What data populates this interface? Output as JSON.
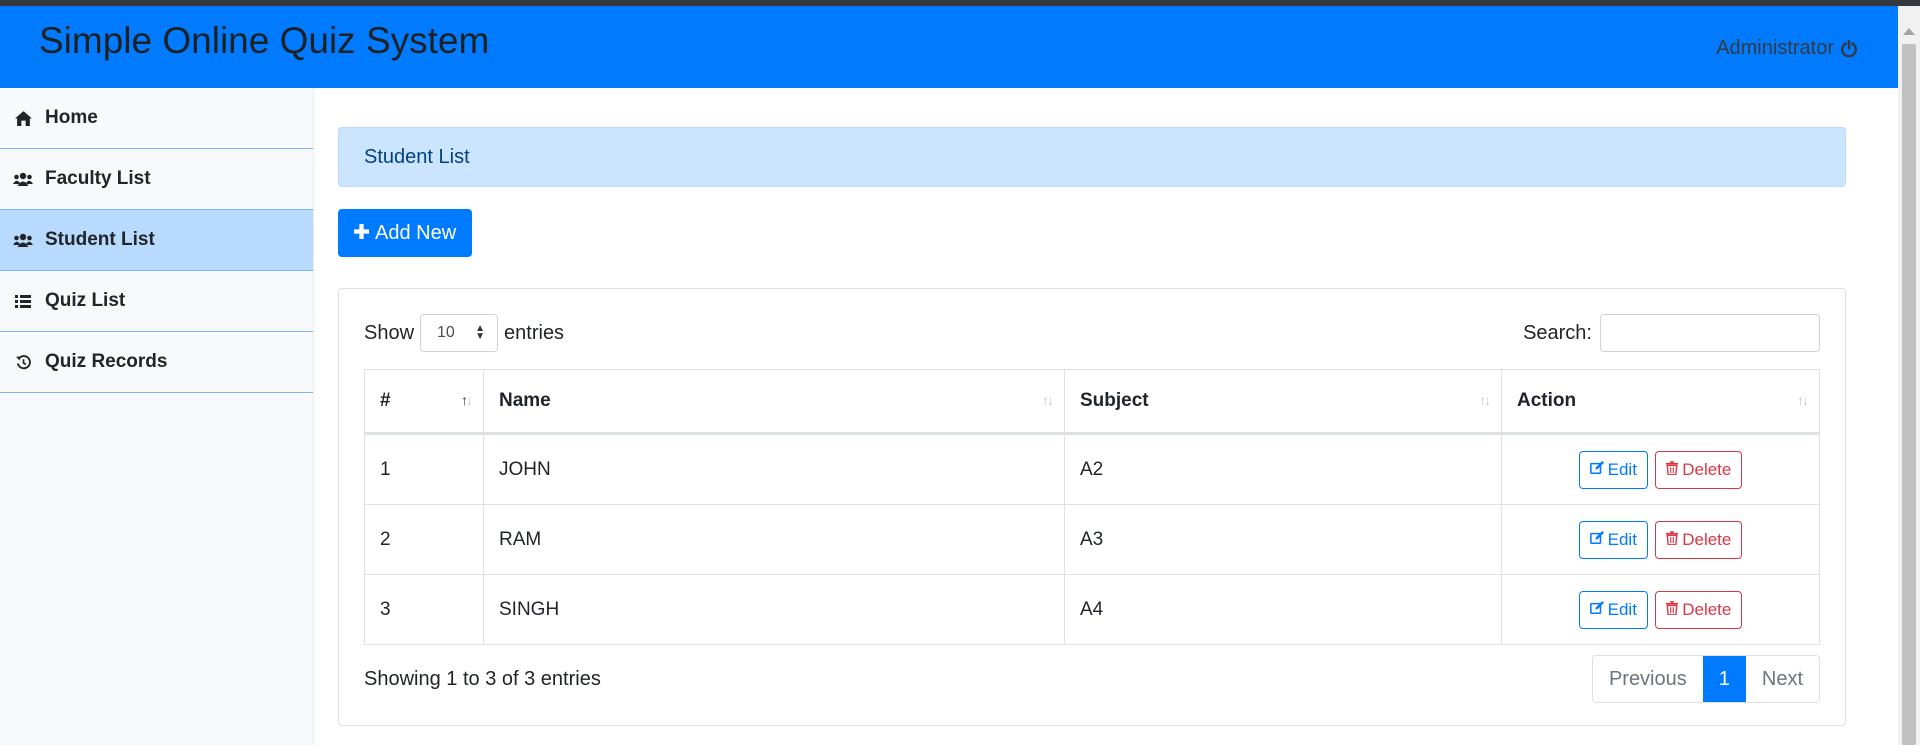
{
  "app": {
    "title": "Simple Online Quiz System",
    "user_label": "Administrator",
    "accent_color": "#007bff"
  },
  "sidebar": {
    "items": [
      {
        "label": "Home",
        "icon": "home-icon"
      },
      {
        "label": "Faculty List",
        "icon": "users-icon"
      },
      {
        "label": "Student List",
        "icon": "users-icon",
        "active": true
      },
      {
        "label": "Quiz List",
        "icon": "list-icon"
      },
      {
        "label": "Quiz Records",
        "icon": "history-icon"
      }
    ]
  },
  "main": {
    "heading": "Student List",
    "add_button_label": "Add New",
    "show_label": "Show",
    "entries_label": "entries",
    "page_length_value": "10",
    "search_label": "Search:",
    "search_value": "",
    "table": {
      "headers": [
        "#",
        "Name",
        "Subject",
        "Action"
      ],
      "rows": [
        {
          "num": "1",
          "name": "JOHN",
          "subject": "A2"
        },
        {
          "num": "2",
          "name": "RAM",
          "subject": "A3"
        },
        {
          "num": "3",
          "name": "SINGH",
          "subject": "A4"
        }
      ],
      "edit_label": "Edit",
      "delete_label": "Delete"
    },
    "info_text": "Showing 1 to 3 of 3 entries",
    "pagination": {
      "previous": "Previous",
      "current": "1",
      "next": "Next"
    }
  }
}
